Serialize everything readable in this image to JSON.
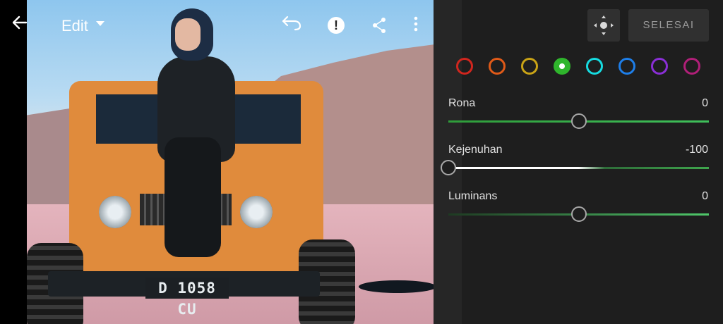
{
  "topbar": {
    "back_icon": "arrow-left-icon",
    "mode_label": "Edit",
    "undo_icon": "undo-icon",
    "alert_icon": "alert-icon",
    "share_icon": "share-icon",
    "more_icon": "more-vertical-icon"
  },
  "photo": {
    "license_plate": "D 1058 CU"
  },
  "panel": {
    "target_icon": "target-adjust-icon",
    "done_label": "SELESAI",
    "colors": [
      {
        "name": "red",
        "hex": "#d1261e",
        "selected": false
      },
      {
        "name": "orange",
        "hex": "#e05a18",
        "selected": false
      },
      {
        "name": "yellow",
        "hex": "#c9a316",
        "selected": false
      },
      {
        "name": "green",
        "hex": "#2fb52c",
        "selected": true
      },
      {
        "name": "aqua",
        "hex": "#16dbe0",
        "selected": false
      },
      {
        "name": "blue",
        "hex": "#1e7ee8",
        "selected": false
      },
      {
        "name": "purple",
        "hex": "#8a2fd6",
        "selected": false
      },
      {
        "name": "magenta",
        "hex": "#b01f78",
        "selected": false
      }
    ],
    "sliders": [
      {
        "label": "Rona",
        "value": "0",
        "position": 0.5
      },
      {
        "label": "Kejenuhan",
        "value": "-100",
        "position": 0.0
      },
      {
        "label": "Luminans",
        "value": "0",
        "position": 0.5
      }
    ]
  }
}
